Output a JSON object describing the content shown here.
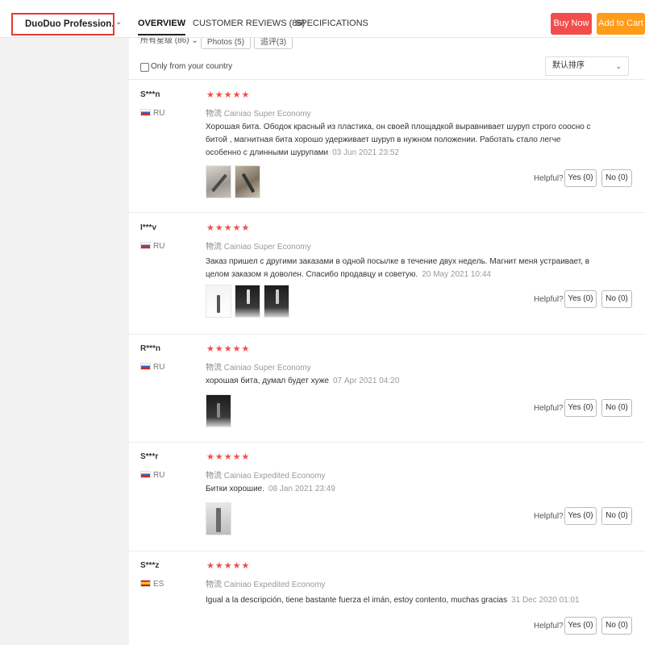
{
  "header": {
    "product_name": "DuoDuo Profession...",
    "tabs": [
      {
        "label": "OVERVIEW",
        "active": true
      },
      {
        "label": "CUSTOMER REVIEWS (86)",
        "active": false
      },
      {
        "label": "SPECIFICATIONS",
        "active": false
      }
    ],
    "buy_now": "Buy Now",
    "add_to_cart": "Add to Cart"
  },
  "filters": {
    "rating_label": "所有星级 (86)",
    "photos_chip": "Photos (5)",
    "additional_chip": "追评(3)",
    "country_checkbox_label": "Only from your country",
    "sort_value": "默认排序"
  },
  "reviews": [
    {
      "user": "S***n",
      "country": "RU",
      "stars": "★★★★★",
      "shipping_prefix": "物流",
      "shipping": "Cainiao Super Economy",
      "text": "Хорошая бита. Ободок красный из пластика, он своей площадкой выравнивает шуруп строго соосно с битой , магнитная бита хорошо удерживает шуруп в нужном положении. Работать стало легче особенно с длинными шурупами",
      "date": "03 Jun 2021 23:52",
      "helpful": "Helpful?",
      "yes": "Yes (0)",
      "no": "No (0)"
    },
    {
      "user": "I***v",
      "country": "RU",
      "stars": "★★★★★",
      "shipping_prefix": "物流",
      "shipping": "Cainiao Super Economy",
      "text": "Заказ пришел с другими заказами в одной посылке в течение двух недель. Магнит меня устраивает, в целом заказом я доволен. Спасибо продавцу и советую.",
      "date": "20 May 2021 10:44",
      "helpful": "Helpful?",
      "yes": "Yes (0)",
      "no": "No (0)"
    },
    {
      "user": "R***n",
      "country": "RU",
      "stars": "★★★★★",
      "shipping_prefix": "物流",
      "shipping": "Cainiao Super Economy",
      "text": "хорошая бита, думал будет хуже",
      "date": "07 Apr 2021 04:20",
      "helpful": "Helpful?",
      "yes": "Yes (0)",
      "no": "No (0)"
    },
    {
      "user": "S***r",
      "country": "RU",
      "stars": "★★★★★",
      "shipping_prefix": "物流",
      "shipping": "Cainiao Expedited Economy",
      "text": "Битки хорошие.",
      "date": "08 Jan 2021 23:49",
      "helpful": "Helpful?",
      "yes": "Yes (0)",
      "no": "No (0)"
    },
    {
      "user": "S***z",
      "country": "ES",
      "stars": "★★★★★",
      "shipping_prefix": "物流",
      "shipping": "Cainiao Expedited Economy",
      "text": "Igual a la descripción, tiene bastante fuerza el imán, estoy contento, muchas gracias",
      "date": "31 Dec 2020 01:01",
      "helpful": "Helpful?",
      "yes": "Yes (0)",
      "no": "No (0)"
    }
  ]
}
